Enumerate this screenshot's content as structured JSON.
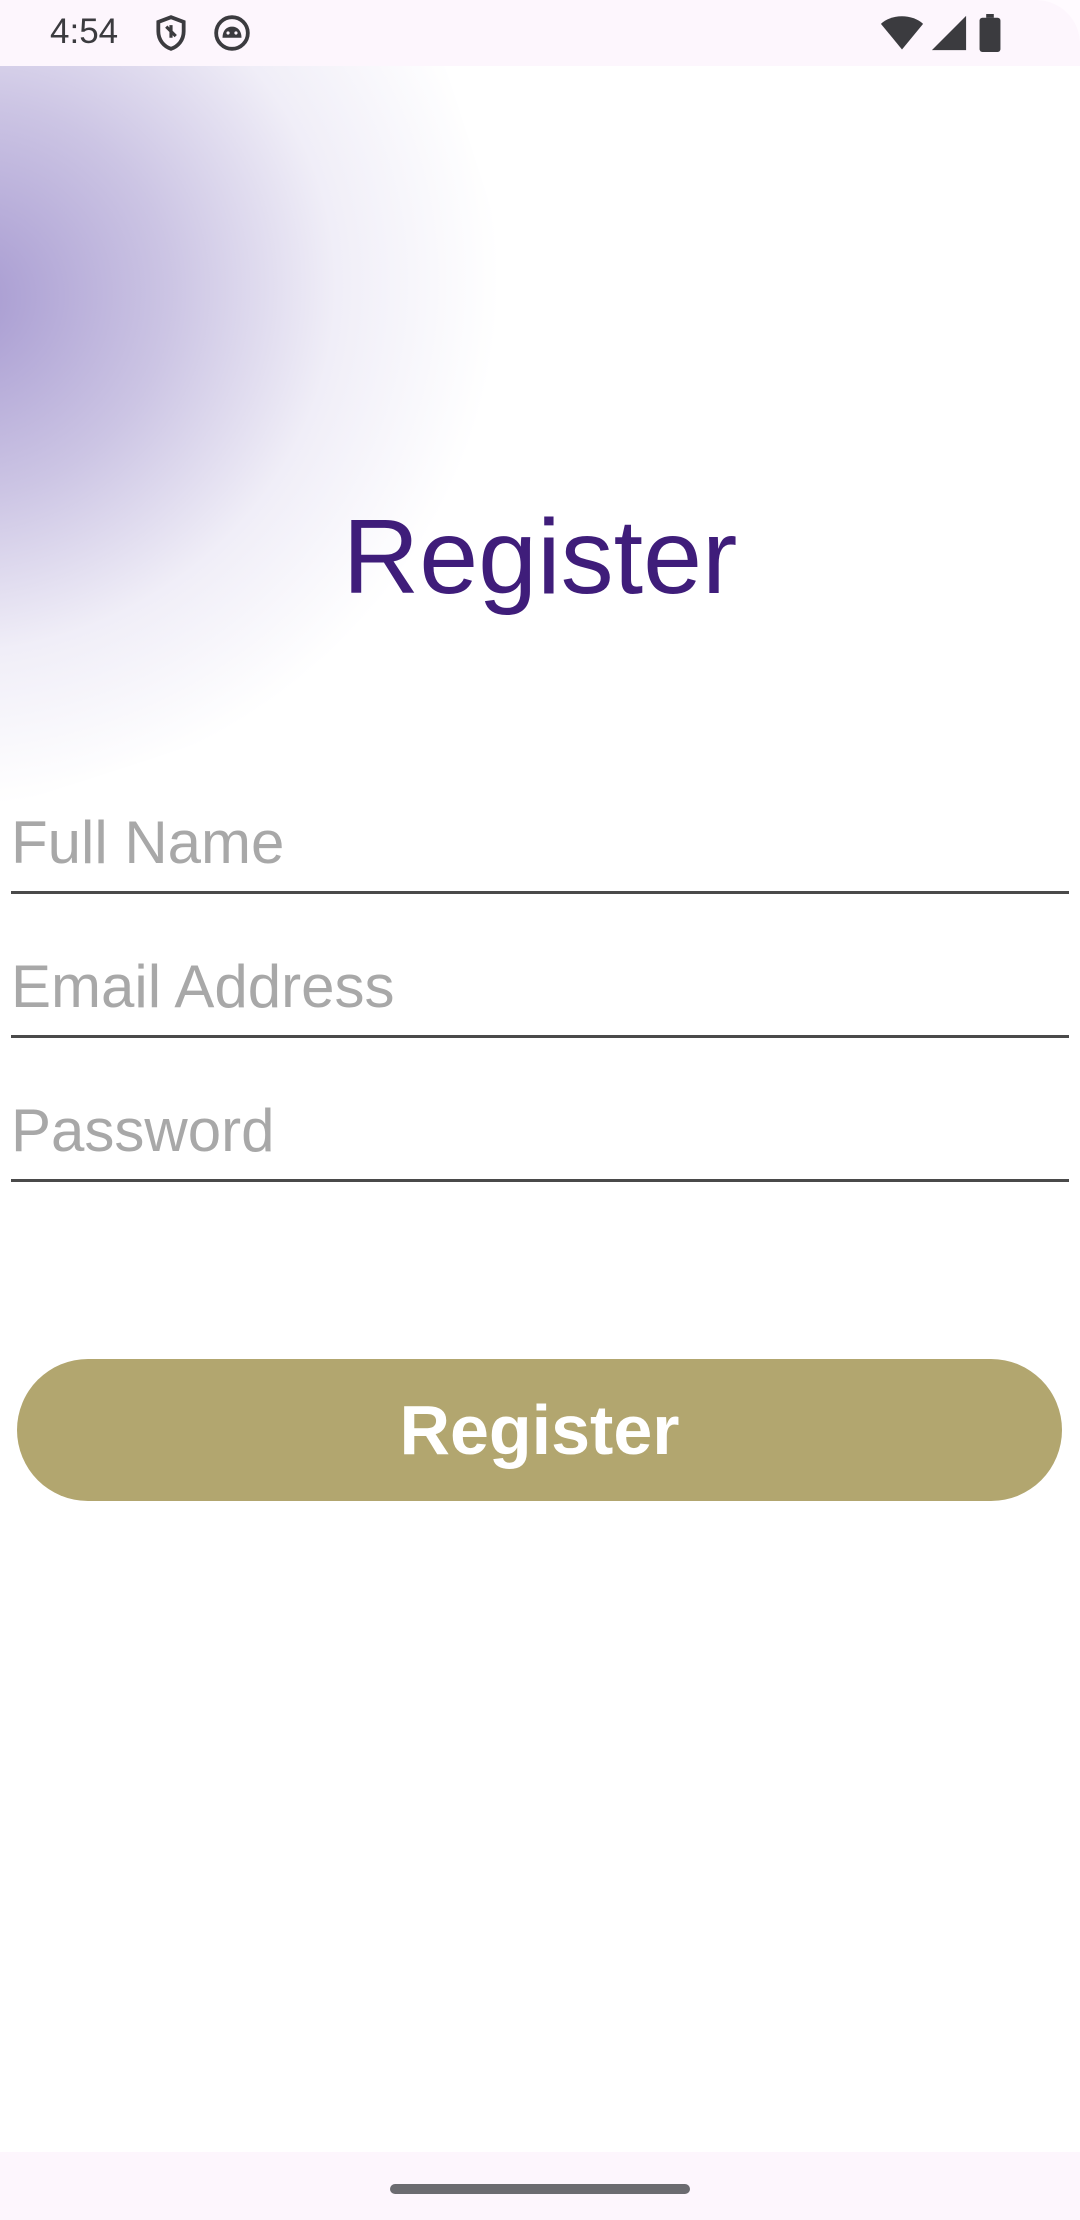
{
  "status_bar": {
    "time": "4:54",
    "icons": [
      "shield-icon",
      "android-icon",
      "wifi-icon",
      "signal-icon",
      "battery-icon"
    ]
  },
  "page": {
    "title": "Register"
  },
  "form": {
    "full_name_placeholder": "Full Name",
    "full_name_value": "",
    "email_placeholder": "Email Address",
    "email_value": "",
    "password_placeholder": "Password",
    "password_value": ""
  },
  "actions": {
    "register_label": "Register"
  },
  "colors": {
    "title": "#3f1d7a",
    "button_bg": "#b2a66f",
    "button_text": "#ffffff",
    "placeholder": "#a8a8a8",
    "underline": "#4a4a4a",
    "glow": "#9687c8"
  }
}
